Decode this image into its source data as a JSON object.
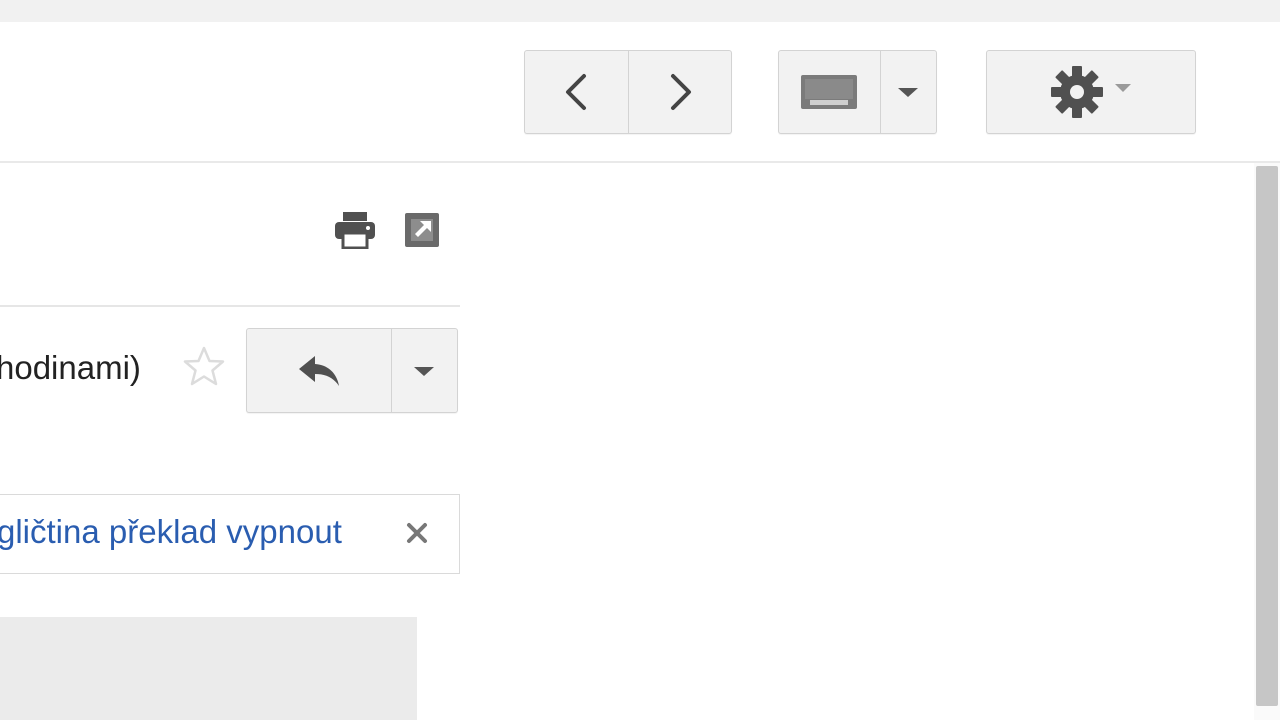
{
  "toolbar": {
    "nav": {
      "prev_icon": "chevron-left-icon",
      "next_icon": "chevron-right-icon"
    },
    "input_tools": {
      "icon": "keyboard-icon",
      "caret_icon": "caret-down-icon"
    },
    "settings": {
      "icon": "gear-icon",
      "caret_icon": "caret-down-icon"
    }
  },
  "message": {
    "actions": {
      "print_icon": "print-icon",
      "popout_icon": "popout-icon"
    },
    "header": {
      "date_text": "hodinami)",
      "star_icon": "star-outline-icon",
      "reply_icon": "reply-icon",
      "more_icon": "caret-down-icon"
    },
    "translate_bar": {
      "text": "gličtina překlad vypnout",
      "close_icon": "close-icon"
    }
  },
  "colors": {
    "link": "#2a5db0",
    "button_bg": "#f2f2f2",
    "icon": "#555555"
  }
}
